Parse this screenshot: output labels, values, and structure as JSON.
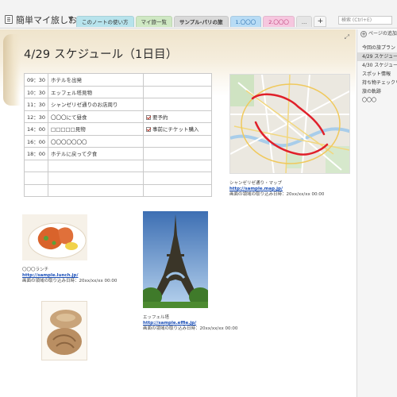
{
  "notebook": {
    "title": "簡単マイ旅しおり"
  },
  "tabs": [
    {
      "label": "このノートの使い方",
      "color": "#b7e3ec"
    },
    {
      "label": "マイ旅一覧",
      "color": "#cfe8c3"
    },
    {
      "label": "サンプル-パリの旅",
      "color": "#d9d9d9"
    },
    {
      "label": "1.〇〇〇",
      "color": "#b8dcf5"
    },
    {
      "label": "2.〇〇〇",
      "color": "#f6c7df"
    },
    {
      "label": "…",
      "color": "#e5e5e5"
    },
    {
      "label": "+"
    }
  ],
  "search": {
    "placeholder": "検索 (Ctrl+E)"
  },
  "page": {
    "title": "4/29 スケジュール（1日目）",
    "schedule": [
      {
        "time": "09：30",
        "activity": "ホテルを出発",
        "note": "",
        "checked": false
      },
      {
        "time": "10：30",
        "activity": "エッフェル塔見物",
        "note": "",
        "checked": false
      },
      {
        "time": "11：30",
        "activity": "シャンゼリゼ通りのお店周り",
        "note": "",
        "checked": false
      },
      {
        "time": "12：30",
        "activity": "〇〇〇にて昼食",
        "note": "要予約",
        "checked": true
      },
      {
        "time": "14：00",
        "activity": "□□□□□見物",
        "note": "事前にチケット購入",
        "checked": true
      },
      {
        "time": "16：00",
        "activity": "〇〇〇〇〇〇〇",
        "note": "",
        "checked": false
      },
      {
        "time": "18：00",
        "activity": "ホテルに戻って夕食",
        "note": "",
        "checked": false
      },
      {
        "time": "",
        "activity": "",
        "note": "",
        "checked": false
      },
      {
        "time": "",
        "activity": "",
        "note": "",
        "checked": false
      },
      {
        "time": "",
        "activity": "",
        "note": "",
        "checked": false
      }
    ],
    "map": {
      "caption": "シャンゼリゼ通り・マップ",
      "link": "http://sample.map.jp/",
      "date": "画面の領域の取り込み日時：20xx/xx/xx 00:00"
    },
    "lunch": {
      "caption": "〇〇〇ランチ",
      "link": "http://sample.lunch.jp/",
      "date": "画面の領域の取り込み日時：20xx/xx/xx 00:00"
    },
    "eiffel": {
      "caption": "エッフェル塔",
      "link": "http://sample.effie.jp/",
      "date": "画面の領域の取り込み日時：20xx/xx/xx 00:00"
    }
  },
  "sidebar": {
    "add_page": "ページの追加",
    "pages": [
      {
        "label": "今回の旅プラン",
        "active": false
      },
      {
        "label": "4/29 スケジュール",
        "active": true
      },
      {
        "label": "4/30 スケジュール",
        "active": false
      },
      {
        "label": "スポット情報",
        "active": false
      },
      {
        "label": "持ち物チェックリスト",
        "active": false
      },
      {
        "label": "旅の軌跡",
        "active": false
      },
      {
        "label": "〇〇〇",
        "active": false
      }
    ]
  },
  "colors": {
    "accent_route": "#e0202a",
    "link": "#1a4fb8"
  }
}
